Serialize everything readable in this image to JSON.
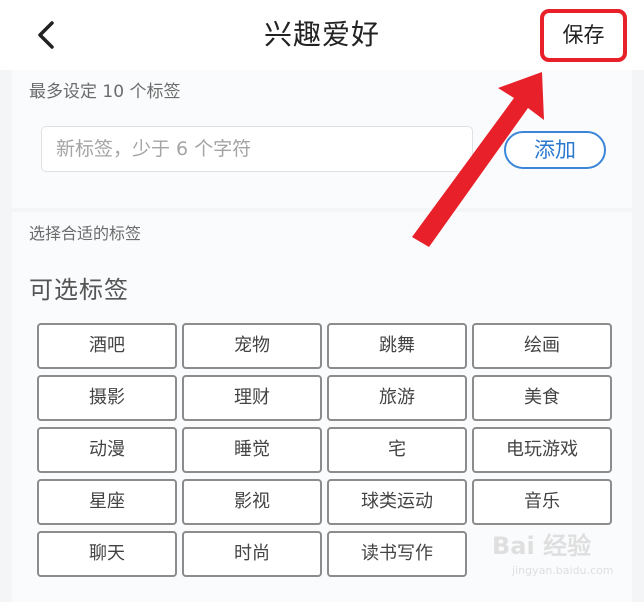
{
  "header": {
    "back_icon": "chevron-left-icon",
    "title": "兴趣爱好",
    "save_label": "保存",
    "highlight_color": "#e8202a"
  },
  "custom_tag": {
    "hint": "最多设定 10 个标签",
    "input_value": "",
    "input_placeholder": "新标签，少于 6 个字符",
    "add_label": "添加",
    "accent_color": "#3b86d8"
  },
  "suggested": {
    "hint": "选择合适的标签",
    "section_title": "可选标签",
    "tags": [
      "酒吧",
      "宠物",
      "跳舞",
      "绘画",
      "摄影",
      "理财",
      "旅游",
      "美食",
      "动漫",
      "睡觉",
      "宅",
      "电玩游戏",
      "星座",
      "影视",
      "球类运动",
      "音乐",
      "聊天",
      "时尚",
      "读书写作"
    ]
  },
  "annotation": {
    "arrow_icon": "red-arrow-icon",
    "arrow_color": "#e8202a"
  },
  "watermark": {
    "main": "Bai 经验",
    "sub": "jingyan.baidu.com"
  }
}
